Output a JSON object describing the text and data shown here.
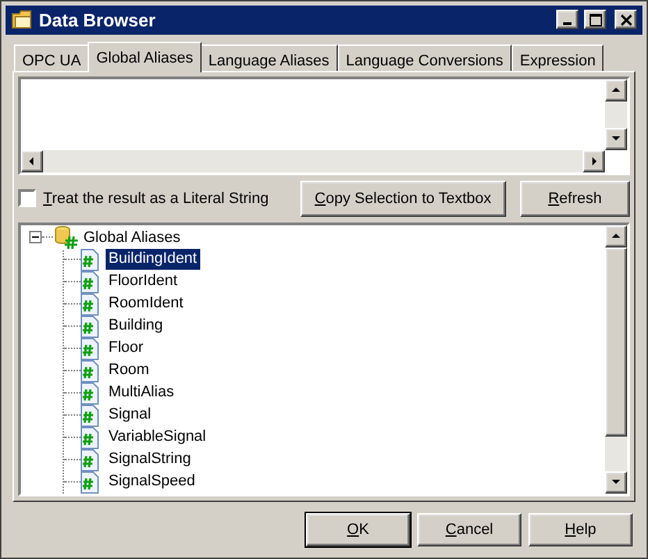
{
  "window": {
    "title": "Data Browser"
  },
  "tabs": [
    {
      "label": "OPC UA",
      "selected": false
    },
    {
      "label": "Global Aliases",
      "selected": true
    },
    {
      "label": "Language Aliases",
      "selected": false
    },
    {
      "label": "Language Conversions",
      "selected": false
    },
    {
      "label": "Expression",
      "selected": false
    }
  ],
  "literal_checkbox": {
    "label": "Treat the result as a Literal String",
    "checked": false,
    "underline_first": true
  },
  "action_buttons": [
    {
      "label": "Copy Selection to Textbox",
      "underline_first": true
    },
    {
      "label": "Refresh",
      "underline_first": true
    }
  ],
  "tree": {
    "label": "Global Aliases",
    "expanded": true,
    "children": [
      {
        "label": "BuildingIdent",
        "selected": true
      },
      {
        "label": "FloorIdent",
        "selected": false
      },
      {
        "label": "RoomIdent",
        "selected": false
      },
      {
        "label": "Building",
        "selected": false
      },
      {
        "label": "Floor",
        "selected": false
      },
      {
        "label": "Room",
        "selected": false
      },
      {
        "label": "MultiAlias",
        "selected": false
      },
      {
        "label": "Signal",
        "selected": false
      },
      {
        "label": "VariableSignal",
        "selected": false
      },
      {
        "label": "SignalString",
        "selected": false
      },
      {
        "label": "SignalSpeed",
        "selected": false
      }
    ]
  },
  "dialog_buttons": [
    {
      "label": "OK",
      "default": true,
      "underline_first": true
    },
    {
      "label": "Cancel",
      "default": false,
      "underline_first": true
    },
    {
      "label": "Help",
      "default": false,
      "underline_first": true
    }
  ]
}
